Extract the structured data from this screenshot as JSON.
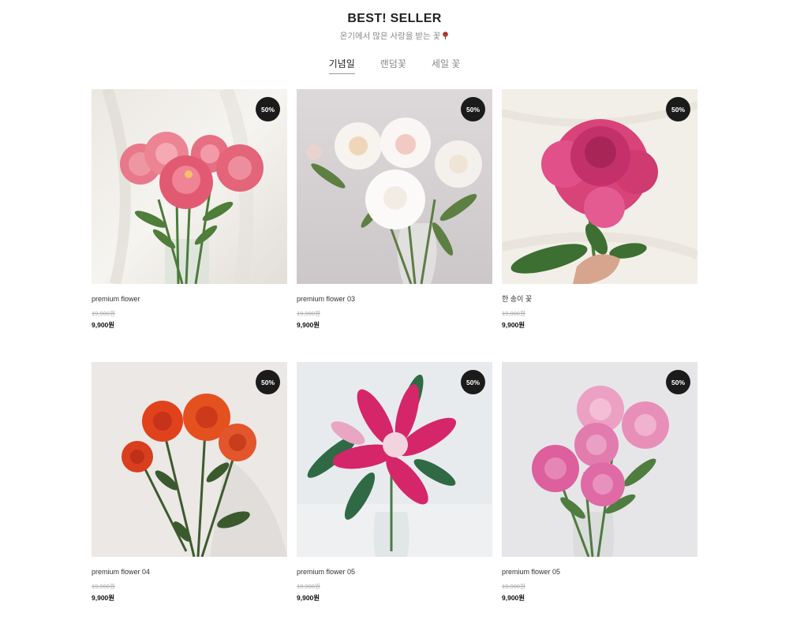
{
  "section": {
    "title": "BEST! SELLER",
    "subtitle": "온기에서 많은 사랑을 받는 꽃"
  },
  "tabs": [
    {
      "label": "기념일",
      "active": true
    },
    {
      "label": "랜덤꽃",
      "active": false
    },
    {
      "label": "세일 꽃",
      "active": false
    }
  ],
  "products": [
    {
      "name": "premium flower",
      "original_price": "19,900원",
      "sale_price": "9,900원",
      "badge": "50%",
      "image": "pink-peony-bouquet-in-vase"
    },
    {
      "name": "premium flower 03",
      "original_price": "19,900원",
      "sale_price": "9,900원",
      "badge": "50%",
      "image": "white-peonies-in-glass-vase"
    },
    {
      "name": "한 송이 꽃",
      "original_price": "19,900원",
      "sale_price": "9,900원",
      "badge": "50%",
      "image": "single-magenta-peony-in-hand"
    },
    {
      "name": "premium flower 04",
      "original_price": "19,900원",
      "sale_price": "9,900원",
      "badge": "50%",
      "image": "orange-red-roses"
    },
    {
      "name": "premium flower 05",
      "original_price": "19,900원",
      "sale_price": "9,900원",
      "badge": "50%",
      "image": "pink-stargazer-lily"
    },
    {
      "name": "premium flower 05",
      "original_price": "19,900원",
      "sale_price": "9,900원",
      "badge": "50%",
      "image": "pink-peonies-in-vase"
    }
  ],
  "colors": {
    "badge_bg": "#1b1b1b",
    "badge_text": "#ffffff",
    "title_text": "#222222",
    "muted_text": "#888888",
    "strike_price": "#aaaaaa"
  }
}
